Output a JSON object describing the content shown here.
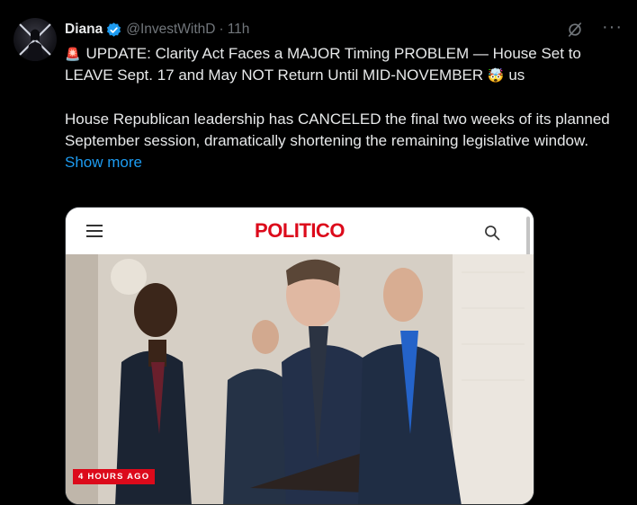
{
  "tweet": {
    "author_name": "Diana",
    "handle": "@InvestWithD",
    "separator": "·",
    "timestamp": "11h",
    "line1": "UPDATE: Clarity Act Faces a MAJOR Timing PROBLEM — House Set to",
    "line2": "LEAVE Sept. 17 and May NOT Return Until MID-NOVEMBER",
    "line2_suffix": "us",
    "paragraph2": "House Republican leadership has CANCELED the final two weeks of its planned September session, dramatically shortening the remaining legislative window.",
    "show_more_label": "Show more",
    "siren_emoji": "🚨",
    "shocked_emoji": "🤯"
  },
  "card": {
    "publisher": "POLITICO",
    "badge": "4 HOURS AGO",
    "brand_color": "#dc0a1b"
  },
  "icons": {
    "verified": "verified-badge-icon",
    "grok": "grok-icon",
    "more": "more-icon",
    "menu": "hamburger-menu-icon",
    "search": "search-icon"
  }
}
